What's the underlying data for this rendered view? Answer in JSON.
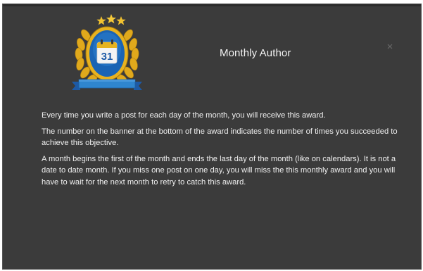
{
  "dialog": {
    "title": "Monthly Author",
    "close_glyph": "×",
    "badge": {
      "day_number": "31",
      "icon": "calendar-laurel-badge-icon",
      "colors": {
        "gold": "#e8b21f",
        "blue": "#1a64b4",
        "banner": "#2f86cf"
      }
    },
    "paragraphs": [
      "Every time you write a post for each day of the month, you will receive this award.",
      "The number on the banner at the bottom of the award indicates the number of times you succeeded to achieve this objective.",
      "A month begins the first of the month and ends the last day of the month (like on calendars). It is not a date to date month. If you miss one post on one day, you will miss the this monthly award and you will have to wait for the next month to retry to catch this award."
    ]
  }
}
